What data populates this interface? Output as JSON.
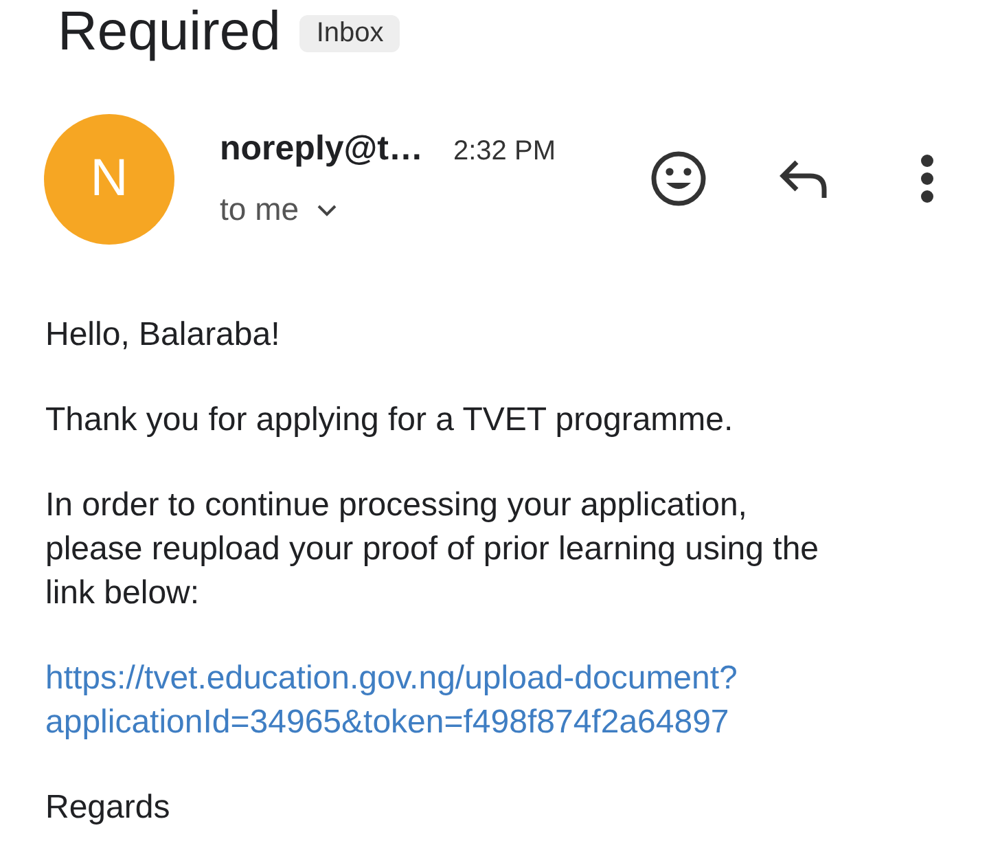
{
  "subject": "Required",
  "label": "Inbox",
  "message": {
    "avatar_letter": "N",
    "sender": "noreply@t…",
    "time": "2:32 PM",
    "recipient": "to me",
    "body": [
      {
        "kind": "text",
        "lines": [
          "Hello, Balaraba!"
        ]
      },
      {
        "kind": "text",
        "lines": [
          "Thank you for applying for a TVET programme."
        ]
      },
      {
        "kind": "text",
        "lines": [
          "In order to continue processing your application,",
          "please reupload your proof of prior learning using the",
          "link below:"
        ]
      },
      {
        "kind": "link",
        "lines": [
          "https://tvet.education.gov.ng/upload-document?",
          "applicationId=34965&token=f498f874f2a64897"
        ]
      },
      {
        "kind": "text",
        "lines": [
          "Regards"
        ]
      }
    ]
  }
}
